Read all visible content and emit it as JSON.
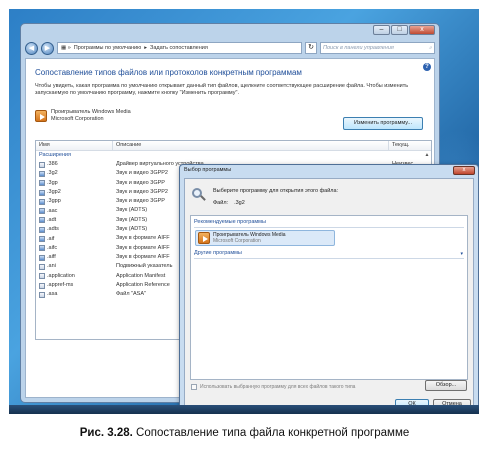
{
  "window": {
    "controls": [
      "–",
      "□",
      "x"
    ],
    "breadcrumb": [
      "Программы по умолчанию",
      "Задать сопоставления"
    ],
    "search_placeholder": "Поиск в панели управления",
    "heading": "Сопоставление типов файлов или протоколов конкретным программам",
    "description": "Чтобы увидеть, какая программа по умолчанию открывает данный тип файлов, щелкните соответствующее расширение файла. Чтобы изменить запускаемую по умолчанию программу, нажмите кнопку \"Изменить программу\".",
    "current_program": {
      "name": "Проигрыватель Windows Media",
      "company": "Microsoft Corporation"
    },
    "change_button": "Изменить программу...",
    "columns": [
      "Имя",
      "Описание",
      "Текущ."
    ],
    "group": "Расширения",
    "rows": [
      {
        "name": ".386",
        "desc": "Драйвер виртуального устройства",
        "def": "Неизвес",
        "icon": "file"
      },
      {
        "name": ".3g2",
        "desc": "Звук и видео 3GPP2",
        "def": "",
        "icon": "media"
      },
      {
        "name": ".3gp",
        "desc": "Звук и видео 3GPP",
        "def": "",
        "icon": "media"
      },
      {
        "name": ".3gp2",
        "desc": "Звук и видео 3GPP2",
        "def": "",
        "icon": "media"
      },
      {
        "name": ".3gpp",
        "desc": "Звук и видео 3GPP",
        "def": "",
        "icon": "media"
      },
      {
        "name": ".aac",
        "desc": "Звук (ADTS)",
        "def": "",
        "icon": "media"
      },
      {
        "name": ".adt",
        "desc": "Звук (ADTS)",
        "def": "",
        "icon": "media"
      },
      {
        "name": ".adts",
        "desc": "Звук (ADTS)",
        "def": "",
        "icon": "media"
      },
      {
        "name": ".aif",
        "desc": "Звук в формате AIFF",
        "def": "",
        "icon": "media"
      },
      {
        "name": ".aifc",
        "desc": "Звук в формате AIFF",
        "def": "",
        "icon": "media"
      },
      {
        "name": ".aiff",
        "desc": "Звук в формате AIFF",
        "def": "",
        "icon": "media"
      },
      {
        "name": ".ani",
        "desc": "Подвижный указатель",
        "def": "",
        "icon": "file"
      },
      {
        "name": ".application",
        "desc": "Application Manifest",
        "def": "",
        "icon": "file"
      },
      {
        "name": ".appref-ms",
        "desc": "Application Reference",
        "def": "",
        "icon": "file"
      },
      {
        "name": ".asa",
        "desc": "Файл \"ASA\"",
        "def": "",
        "icon": "file"
      }
    ]
  },
  "dialog": {
    "title": "Выбор программы",
    "question": "Выберите программу для открытия этого файла:",
    "file_label": "Файл:",
    "file_name": ".3g2",
    "recommended_heading": "Рекомендуемые программы",
    "recommended": {
      "name": "Проигрыватель Windows Media",
      "company": "Microsoft Corporation"
    },
    "other_heading": "Другие программы",
    "checkbox_label": "Использовать выбранную программу для всех файлов такого типа",
    "browse_button": "Обзор...",
    "ok_button": "ОК",
    "cancel_button": "Отмена"
  },
  "caption": {
    "label": "Рис. 3.28.",
    "text": "Сопоставление типа файла конкретной программе"
  }
}
